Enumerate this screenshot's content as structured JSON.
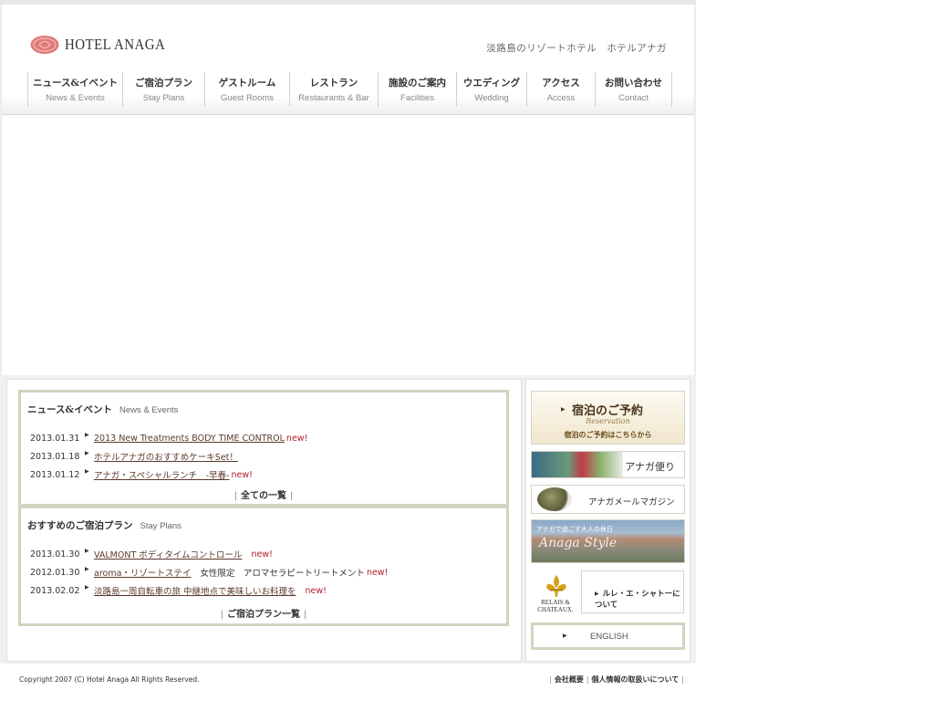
{
  "header": {
    "logo_text": "HOTEL ANAGA",
    "tagline": "淡路島のリゾートホテル　ホテルアナガ"
  },
  "nav": [
    {
      "jp": "ニュース&イベント",
      "en": "News & Events"
    },
    {
      "jp": "ご宿泊プラン",
      "en": "Stay Plans"
    },
    {
      "jp": "ゲストルーム",
      "en": "Guest Rooms"
    },
    {
      "jp": "レストラン",
      "en": "Restaurants & Bar"
    },
    {
      "jp": "施設のご案内",
      "en": "Facilities"
    },
    {
      "jp": "ウエディング",
      "en": "Wedding"
    },
    {
      "jp": "アクセス",
      "en": "Access"
    },
    {
      "jp": "お問い合わせ",
      "en": "Contact"
    }
  ],
  "news": {
    "title_jp": "ニュース&イベント",
    "title_en": "News & Events",
    "items": [
      {
        "date": "2013.01.31",
        "text": "2013 New Treatments BODY TIME CONTROL ",
        "new": "new!"
      },
      {
        "date": "2013.01.18",
        "text": "ホテルアナガのおすすめケーキSet！",
        "new": ""
      },
      {
        "date": "2013.01.12",
        "text": "アナガ・スペシャルランチ　-早春-",
        "new": "new!"
      }
    ],
    "more": "全ての一覧"
  },
  "plans": {
    "title_jp": "おすすめのご宿泊プラン",
    "title_en": "Stay Plans",
    "items": [
      {
        "date": "2013.01.30",
        "text": "VALMONT ボディタイムコントロール",
        "extra": "",
        "new": "new!"
      },
      {
        "date": "2012.01.30",
        "text": "aroma・リゾートステイ",
        "extra": "女性限定　アロマセラピートリートメント",
        "new": "new!"
      },
      {
        "date": "2013.02.02",
        "text": "淡路島一周自転車の旅 中継地点で美味しいお料理を",
        "extra": "",
        "new": "new!"
      }
    ],
    "more": "ご宿泊プラン一覧"
  },
  "sidebar": {
    "reservation": {
      "title": "宿泊のご予約",
      "sub": "Reservation",
      "note": "宿泊のご予約はこちらから"
    },
    "tayori": "アナガ便り",
    "mail": "アナガメールマガジン",
    "style": {
      "small": "アナガで過ごす大人の休日",
      "big": "Anaga Style"
    },
    "relais": {
      "logo": "RELAIS &\nCHATEAUX.",
      "label": "ルレ・エ・シャトーについて"
    },
    "english": "ENGLISH"
  },
  "footer": {
    "copyright": "Copyright 2007 (C) Hotel Anaga All Rights Reserved.",
    "links": [
      "会社概要",
      "個人情報の取扱いについて"
    ]
  },
  "colors": {
    "accent_new": "#b0202a",
    "panel_border": "#d3d3c0",
    "logo_pink": "#e07a78"
  }
}
